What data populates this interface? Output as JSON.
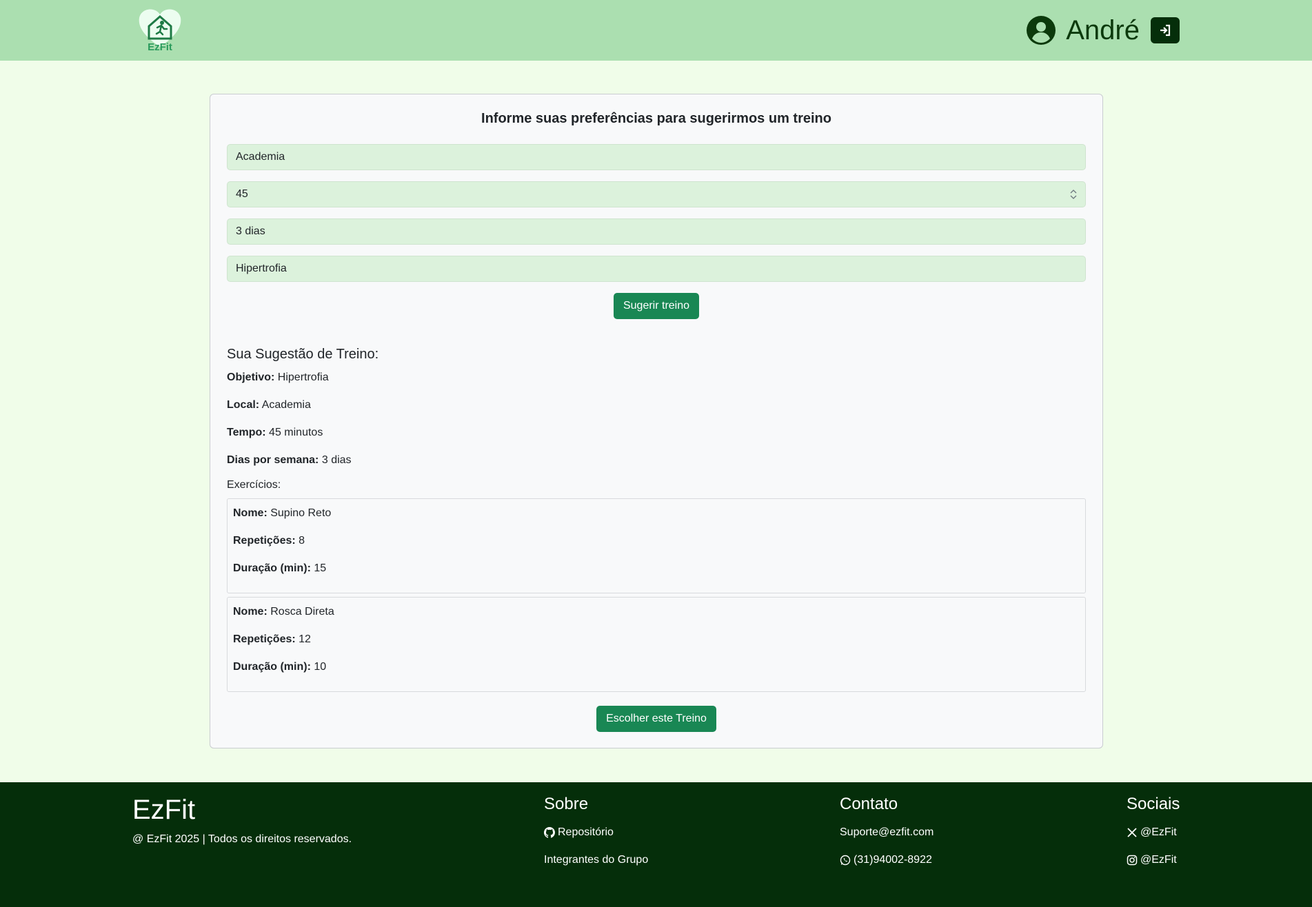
{
  "header": {
    "logo_text": "EzFit",
    "user_name": "André"
  },
  "form": {
    "title": "Informe suas preferências para sugerirmos um treino",
    "local": "Academia",
    "tempo": "45",
    "dias": "3 dias",
    "objetivo": "Hipertrofia",
    "submit_label": "Sugerir treino"
  },
  "result": {
    "title": "Sua Sugestão de Treino:",
    "objetivo_label": "Objetivo:",
    "objetivo_value": "Hipertrofia",
    "local_label": "Local:",
    "local_value": "Academia",
    "tempo_label": "Tempo:",
    "tempo_value": "45 minutos",
    "dias_label": "Dias por semana:",
    "dias_value": "3 dias",
    "exercises_heading": "Exercícios:",
    "exercises": [
      {
        "nome_label": "Nome:",
        "nome": "Supino Reto",
        "reps_label": "Repetições:",
        "reps": "8",
        "dur_label": "Duração (min):",
        "dur": "15"
      },
      {
        "nome_label": "Nome:",
        "nome": "Rosca Direta",
        "reps_label": "Repetições:",
        "reps": "12",
        "dur_label": "Duração (min):",
        "dur": "10"
      }
    ],
    "choose_label": "Escolher este Treino"
  },
  "footer": {
    "brand": "EzFit",
    "copyright": "@ EzFit 2025 | Todos os direitos reservados.",
    "sobre_title": "Sobre",
    "repo_link": "Repositório",
    "members_link": "Integrantes do Grupo",
    "contato_title": "Contato",
    "email": "Suporte@ezfit.com",
    "phone": "(31)94002-8922",
    "sociais_title": "Sociais",
    "x_handle": "@EzFit",
    "instagram_handle": "@EzFit"
  },
  "colors": {
    "header_bg": "#abdfb0",
    "page_bg": "#f0fde9",
    "footer_bg": "#052e0a",
    "button_green": "#198754",
    "field_bg": "#dcf2dc"
  },
  "icons": [
    "ezfit-logo-icon",
    "user-circle-icon",
    "sign-in-icon",
    "github-icon",
    "whatsapp-icon",
    "x-twitter-icon",
    "instagram-icon",
    "spinner-arrows-icon"
  ]
}
